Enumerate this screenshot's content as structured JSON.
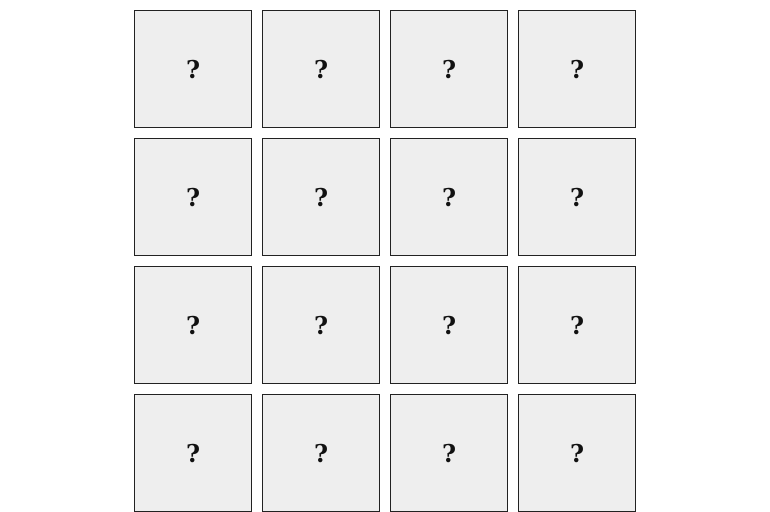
{
  "board": {
    "card_face": "?",
    "card_color": "#eeeeee",
    "border_color": "#222222",
    "cards": [
      {
        "face": "?"
      },
      {
        "face": "?"
      },
      {
        "face": "?"
      },
      {
        "face": "?"
      },
      {
        "face": "?"
      },
      {
        "face": "?"
      },
      {
        "face": "?"
      },
      {
        "face": "?"
      },
      {
        "face": "?"
      },
      {
        "face": "?"
      },
      {
        "face": "?"
      },
      {
        "face": "?"
      },
      {
        "face": "?"
      },
      {
        "face": "?"
      },
      {
        "face": "?"
      },
      {
        "face": "?"
      }
    ]
  }
}
